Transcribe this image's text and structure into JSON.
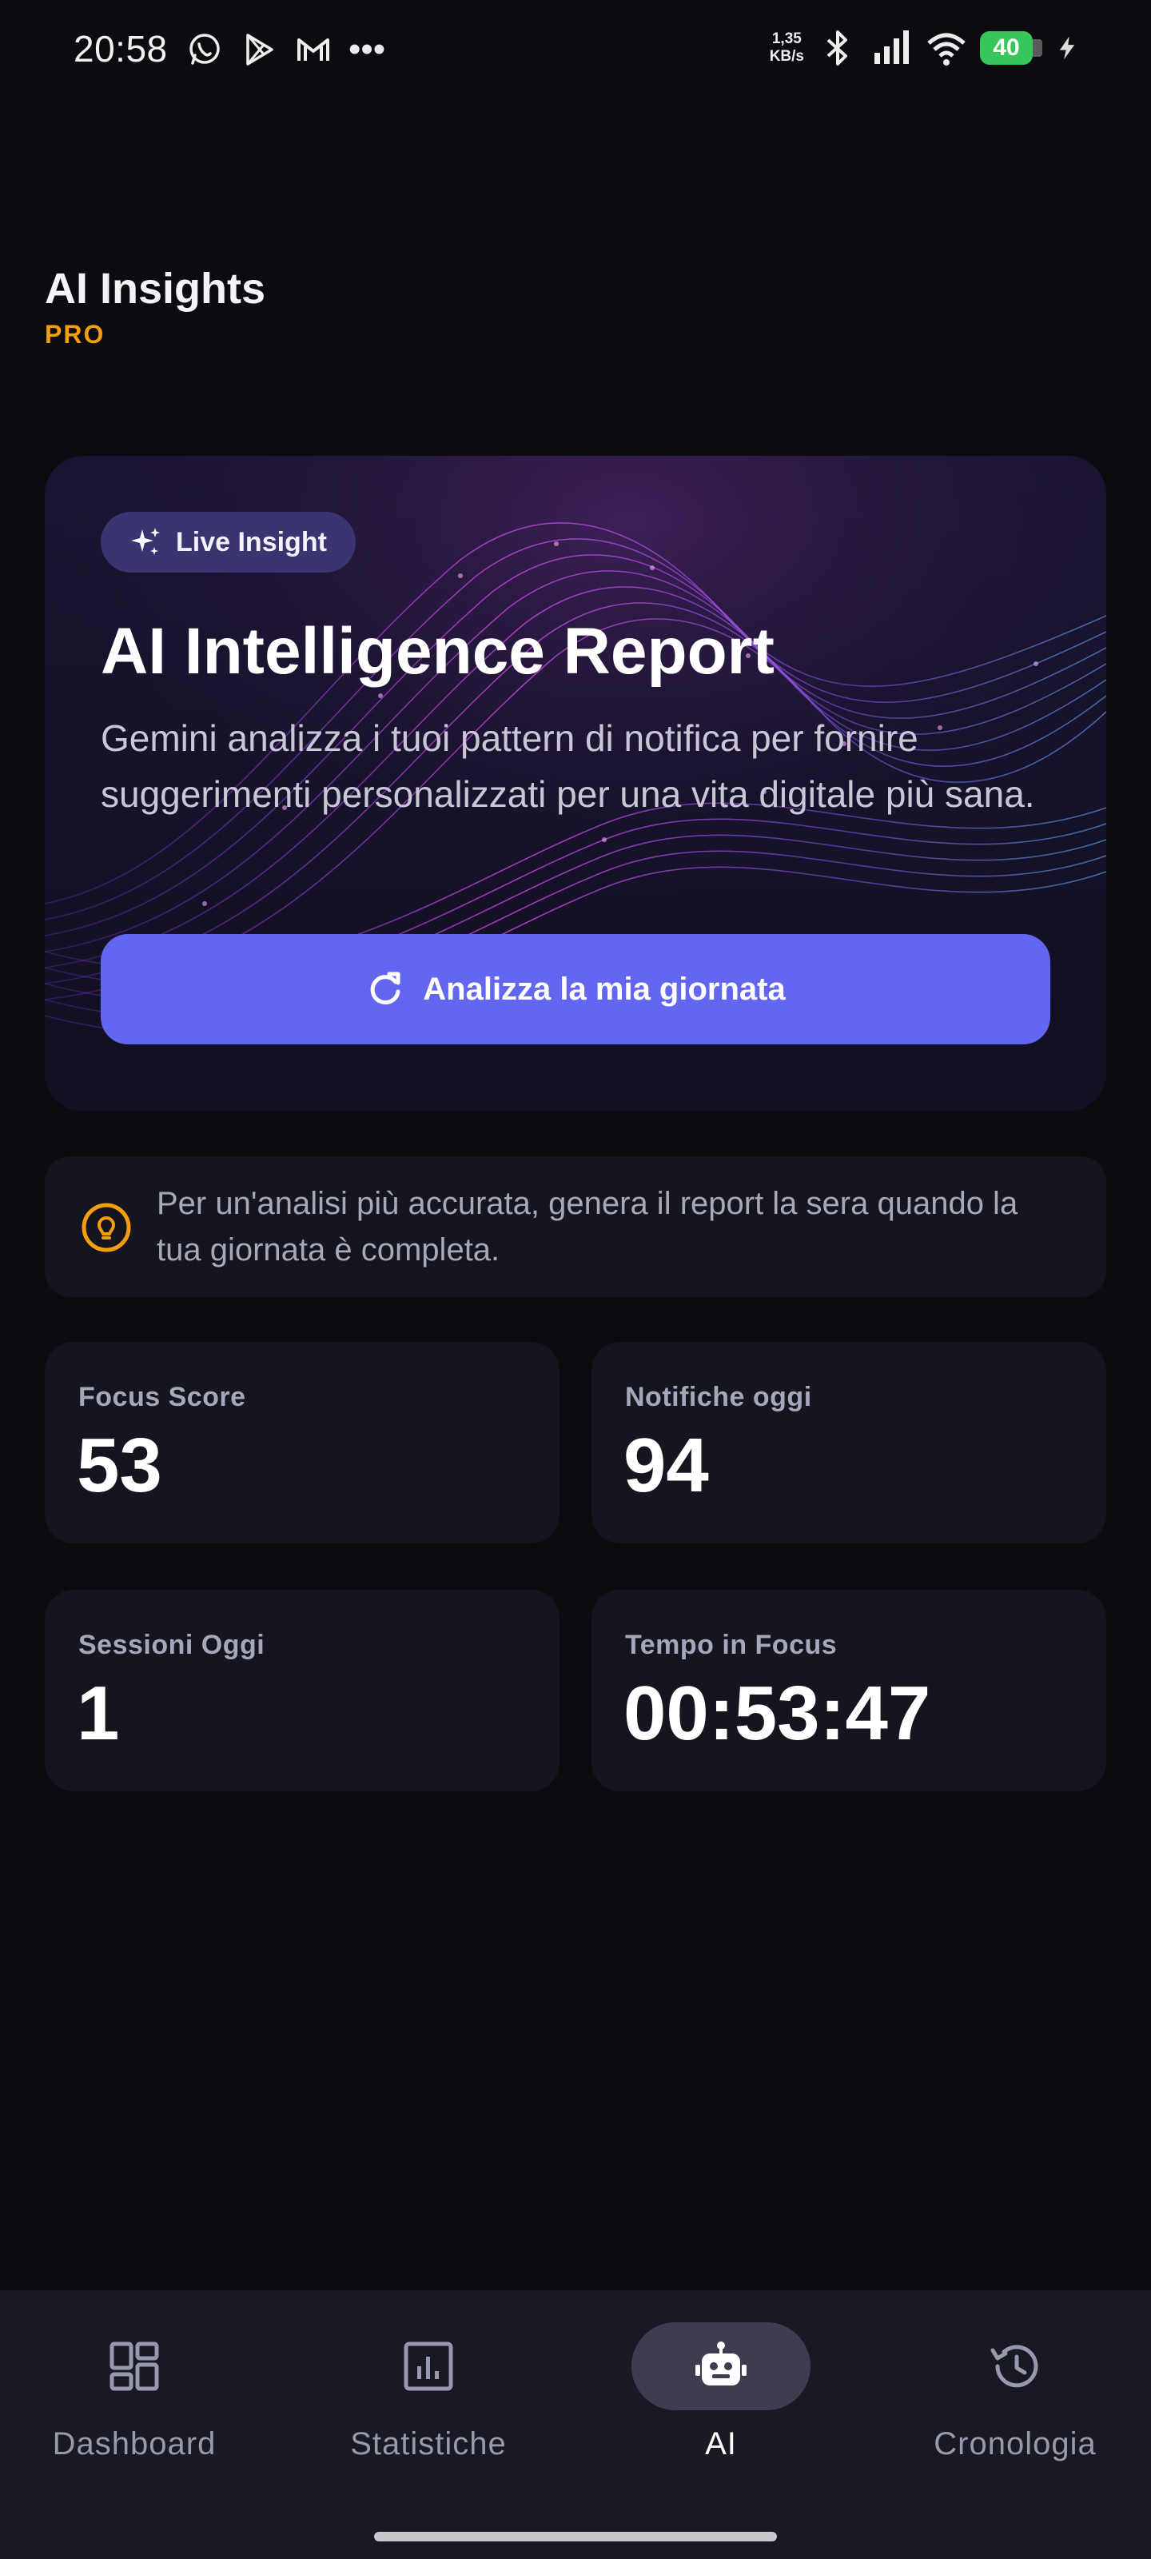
{
  "status_bar": {
    "time": "20:58",
    "speed_value": "1,35",
    "speed_unit": "KB/s",
    "battery": "40"
  },
  "header": {
    "title": "AI Insights",
    "badge": "PRO"
  },
  "hero": {
    "pill_label": "Live Insight",
    "title": "AI Intelligence Report",
    "description": "Gemini analizza i tuoi pattern di notifica per fornire suggerimenti personalizzati per una vita digitale più sana.",
    "button_label": "Analizza la mia giornata"
  },
  "tip": {
    "text": "Per un'analisi più accurata, genera il report la sera quando la tua giornata è completa."
  },
  "stats": [
    {
      "label": "Focus Score",
      "value": "53"
    },
    {
      "label": "Notifiche oggi",
      "value": "94"
    },
    {
      "label": "Sessioni Oggi",
      "value": "1"
    },
    {
      "label": "Tempo in Focus",
      "value": "00:53:47"
    }
  ],
  "nav": {
    "items": [
      {
        "label": "Dashboard",
        "icon": "dashboard-icon",
        "active": false
      },
      {
        "label": "Statistiche",
        "icon": "chart-icon",
        "active": false
      },
      {
        "label": "AI",
        "icon": "robot-icon",
        "active": true
      },
      {
        "label": "Cronologia",
        "icon": "history-icon",
        "active": false
      }
    ]
  },
  "colors": {
    "accent": "#6366f1",
    "badge": "#f59e0b",
    "background": "#0b0b10",
    "card": "#15151f"
  }
}
